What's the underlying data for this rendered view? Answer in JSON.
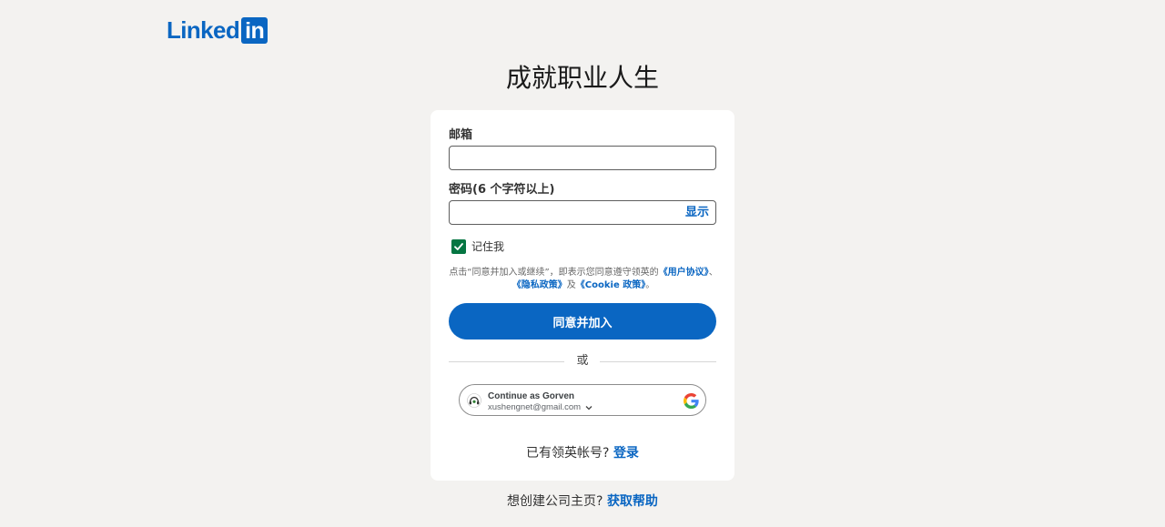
{
  "brand": {
    "logo_word": "Linked",
    "logo_box": "in",
    "color": "#0a66c2"
  },
  "headline": "成就职业人生",
  "form": {
    "email_label": "邮箱",
    "email_value": "",
    "password_label": "密码(6 个字符以上)",
    "password_value": "",
    "show_label": "显示",
    "remember_label": "记住我",
    "remember_checked": true,
    "terms_prefix": "点击“同意并加入或继续”，即表示您同意遵守领英的",
    "terms_user_agreement": "《用户协议》",
    "terms_sep1": "、",
    "terms_privacy": "《隐私政策》",
    "terms_and": "及",
    "terms_cookie": "《Cookie 政策》",
    "terms_end": "。",
    "submit_label": "同意并加入",
    "or_label": "或"
  },
  "google": {
    "name_line": "Continue as Gorven",
    "email": "xushengnet@gmail.com",
    "icon": "google-g-icon"
  },
  "signin": {
    "prompt": "已有领英帐号?",
    "link": "登录"
  },
  "footer": {
    "prompt": "想创建公司主页?",
    "link": "获取帮助"
  }
}
